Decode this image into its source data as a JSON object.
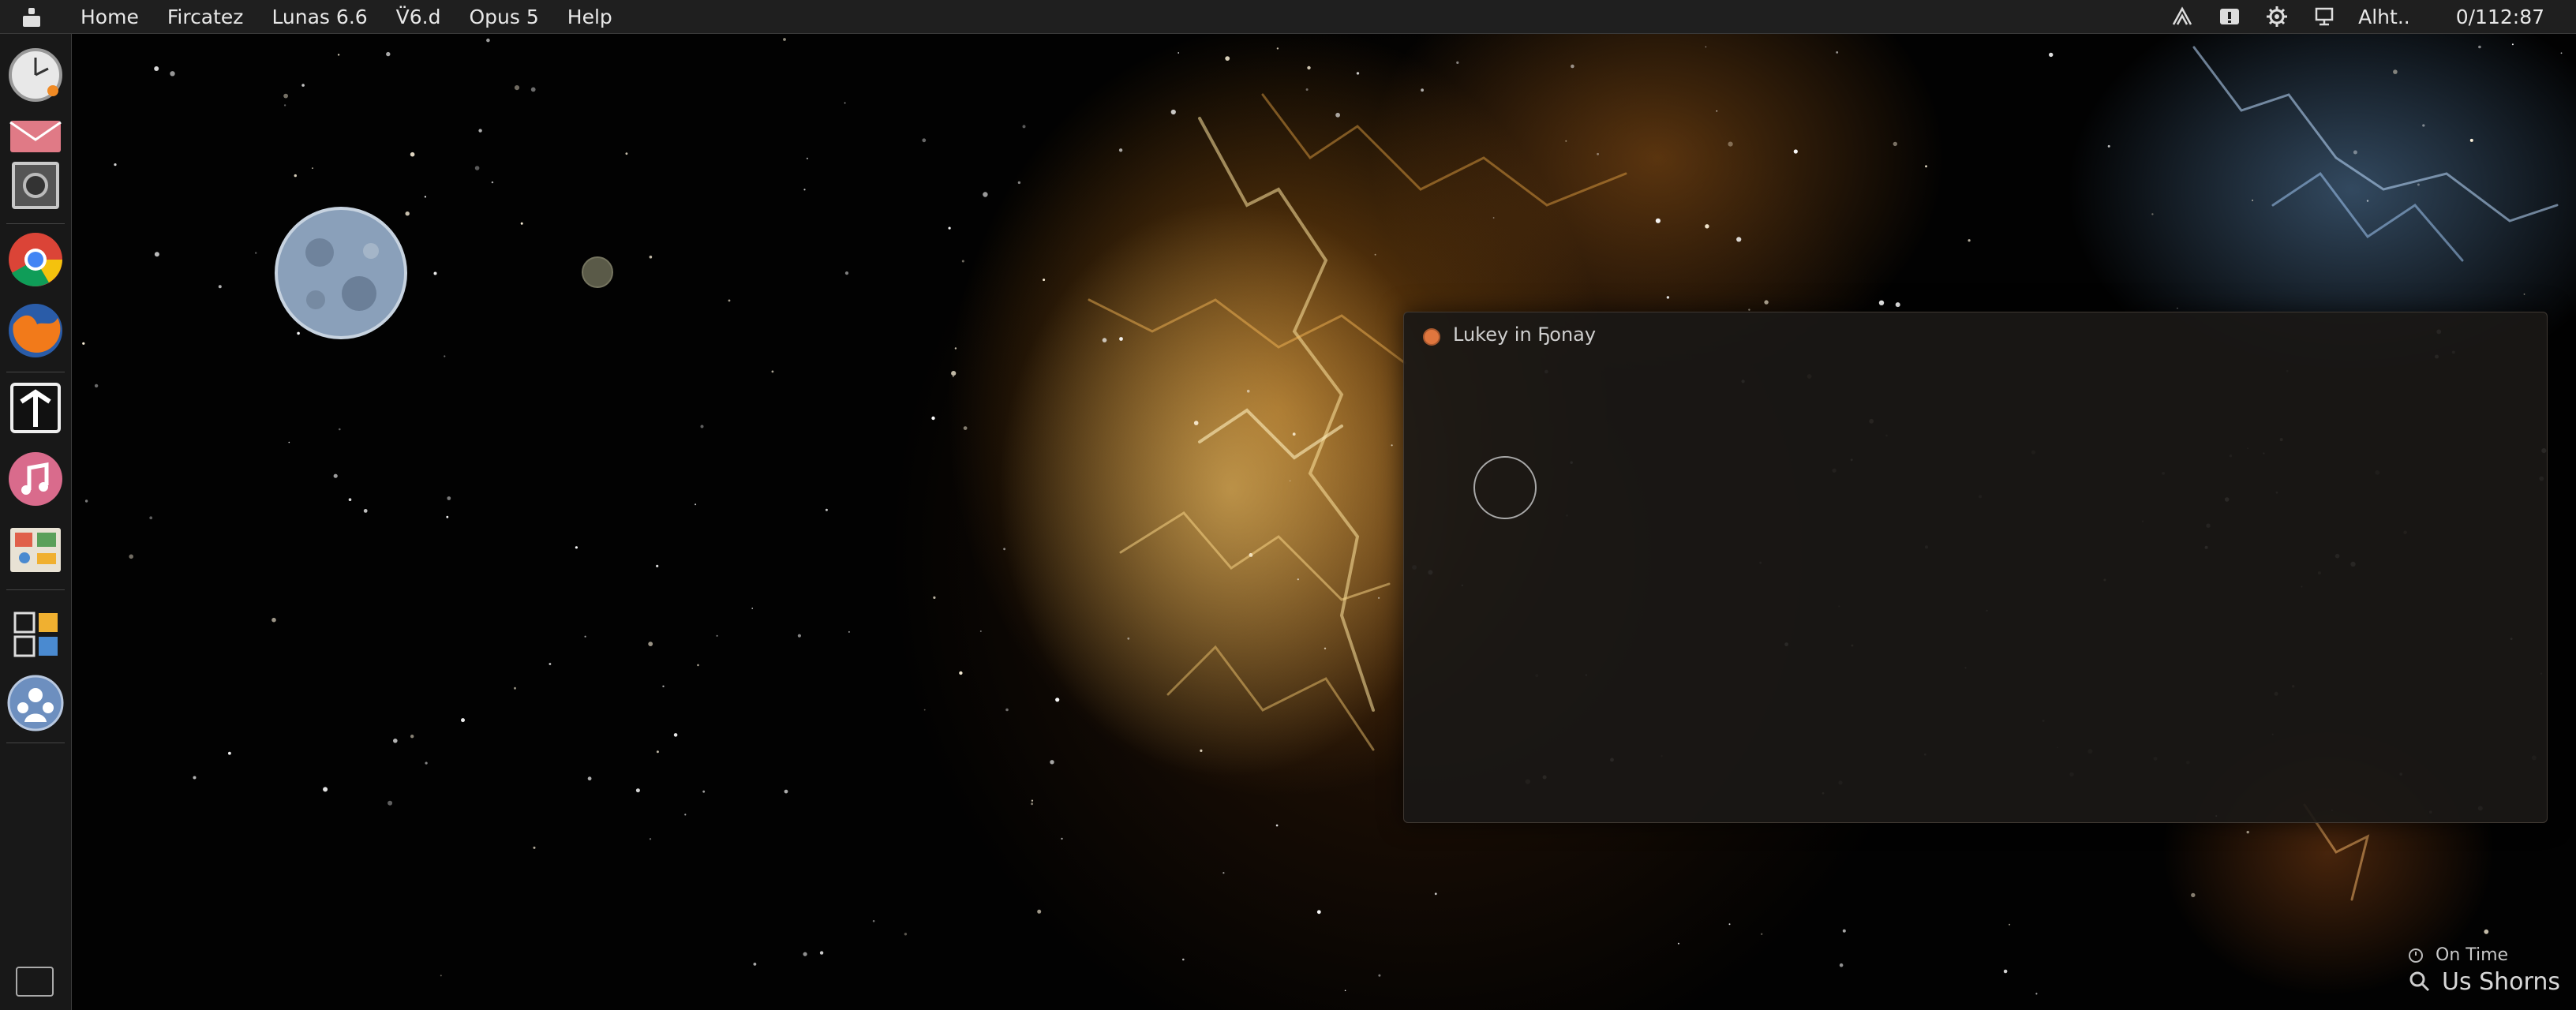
{
  "menubar": {
    "items": [
      "Home",
      "Fircatez",
      "Lunas 6.6",
      "V̈6.d",
      "Opus 5",
      "Help"
    ],
    "status_text": "Alht..",
    "clock": "0/112:87",
    "status_icons": [
      "network-icon",
      "notification-icon",
      "settings-gear-icon",
      "display-icon"
    ]
  },
  "dock": {
    "items": [
      "clock-icon",
      "mail-icon",
      "camera-icon",
      "chrome-icon",
      "firefox-icon",
      "text-editor-icon",
      "music-icon",
      "documents-icon",
      "apps-grid-icon",
      "user-accounts-icon"
    ]
  },
  "window": {
    "title": "Lukey in Ҕonay"
  },
  "widget": {
    "line1": "On Time",
    "line2": "Us Shorns"
  },
  "colors": {
    "menubar_bg": "#1f1f1f",
    "window_bg": "#1a1816",
    "close_button": "#e0763e"
  }
}
